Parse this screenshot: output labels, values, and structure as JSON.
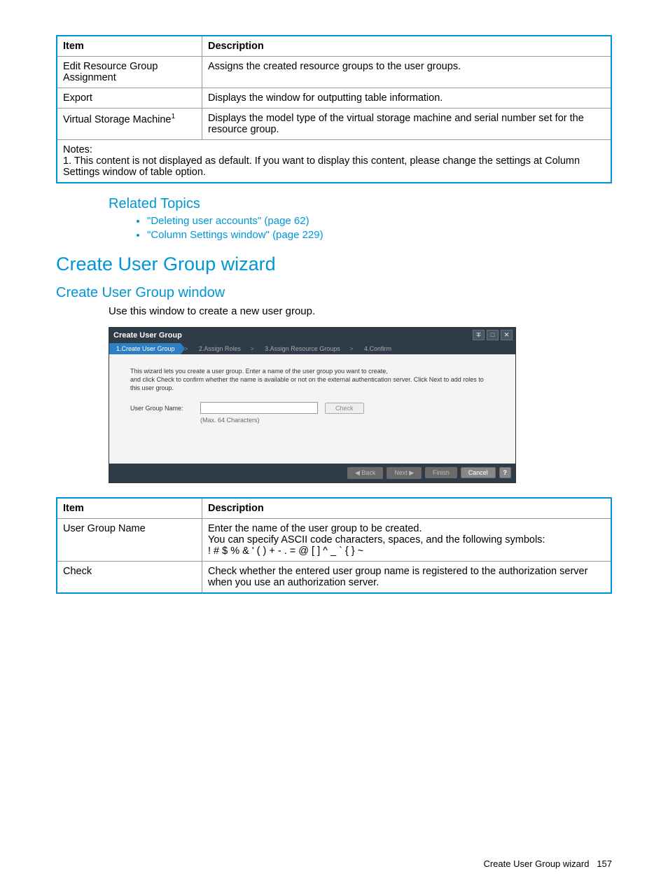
{
  "table1": {
    "headers": {
      "item": "Item",
      "desc": "Description"
    },
    "rows": [
      {
        "item": "Edit Resource Group Assignment",
        "desc": "Assigns the created resource groups to the user groups."
      },
      {
        "item": "Export",
        "desc": "Displays the window for outputting table information."
      },
      {
        "item_prefix": "Virtual Storage Machine",
        "sup": "1",
        "desc": "Displays the model type of the virtual storage machine and serial number set for the resource group."
      }
    ],
    "notes_label": "Notes:",
    "notes_text": "1. This content is not displayed as default. If you want to display this content, please change the settings at Column Settings window of table option."
  },
  "related": {
    "heading": "Related Topics",
    "items": [
      "\"Deleting user accounts\" (page 62)",
      "\"Column Settings window\" (page 229)"
    ]
  },
  "h1": "Create User Group wizard",
  "h2": "Create User Group window",
  "intro": "Use this window to create a new user group.",
  "wizard": {
    "title": "Create User Group",
    "steps": {
      "s1": "1.Create User Group",
      "s2": "2.Assign Roles",
      "s3": "3.Assign Resource Groups",
      "s4": "4.Confirm",
      "sep": ">"
    },
    "desc_line1": "This wizard lets you create a user group. Enter a name of the user group you want to create,",
    "desc_line2": "and click Check to confirm whether the name is available or not on the external authentication server. Click Next to add roles to this user group.",
    "label": "User Group Name:",
    "input_value": "",
    "check_btn": "Check",
    "hint": "(Max. 64 Characters)",
    "footer": {
      "back": "◀ Back",
      "next": "Next ▶",
      "finish": "Finish",
      "cancel": "Cancel",
      "help": "?"
    }
  },
  "table2": {
    "headers": {
      "item": "Item",
      "desc": "Description"
    },
    "rows": [
      {
        "item": "User Group Name",
        "desc": "Enter the name of the user group to be created.\nYou can specify ASCII code characters, spaces, and the following symbols:\n! # $ % & ' ( ) + - . = @ [ ] ^ _ ` { } ~"
      },
      {
        "item": "Check",
        "desc": "Check whether the entered user group name is registered to the authorization server when you use an authorization server."
      }
    ]
  },
  "footer": {
    "title": "Create User Group wizard",
    "page": "157"
  }
}
